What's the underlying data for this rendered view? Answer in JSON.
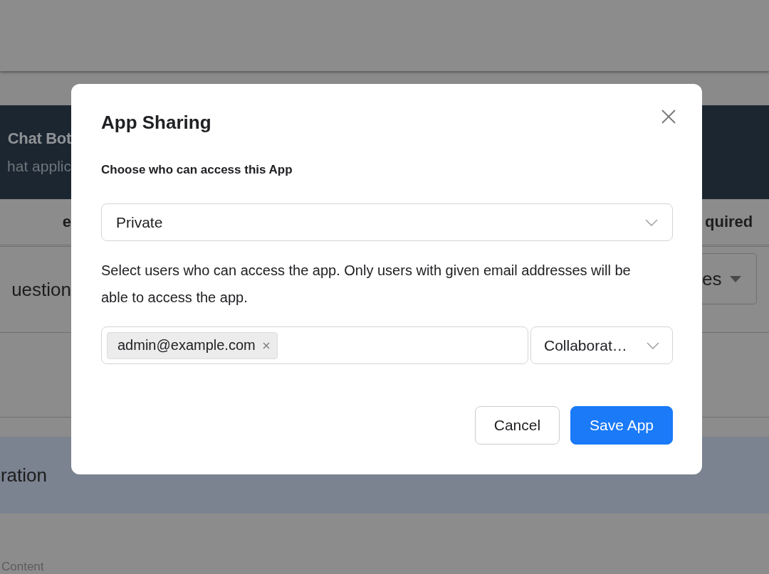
{
  "background": {
    "banner": {
      "title": "Chat Bot",
      "subtitle": "hat applic"
    },
    "table": {
      "header_left": "e",
      "header_right": "quired",
      "row_left": "uestion",
      "row_dropdown": "es"
    },
    "band": {
      "text": "ration"
    },
    "footer": {
      "text": "Content"
    }
  },
  "dialog": {
    "title": "App Sharing",
    "access_label": "Choose who can access this App",
    "access_select": {
      "value": "Private"
    },
    "description": "Select users who can access the app. Only users with given email addresses will be able to access the app.",
    "recipients": [
      {
        "email": "admin@example.com"
      }
    ],
    "role_select": {
      "value": "Collaborat…"
    },
    "buttons": [
      {
        "label": "Cancel",
        "kind": "secondary"
      },
      {
        "label": "Save App",
        "kind": "primary"
      }
    ]
  }
}
